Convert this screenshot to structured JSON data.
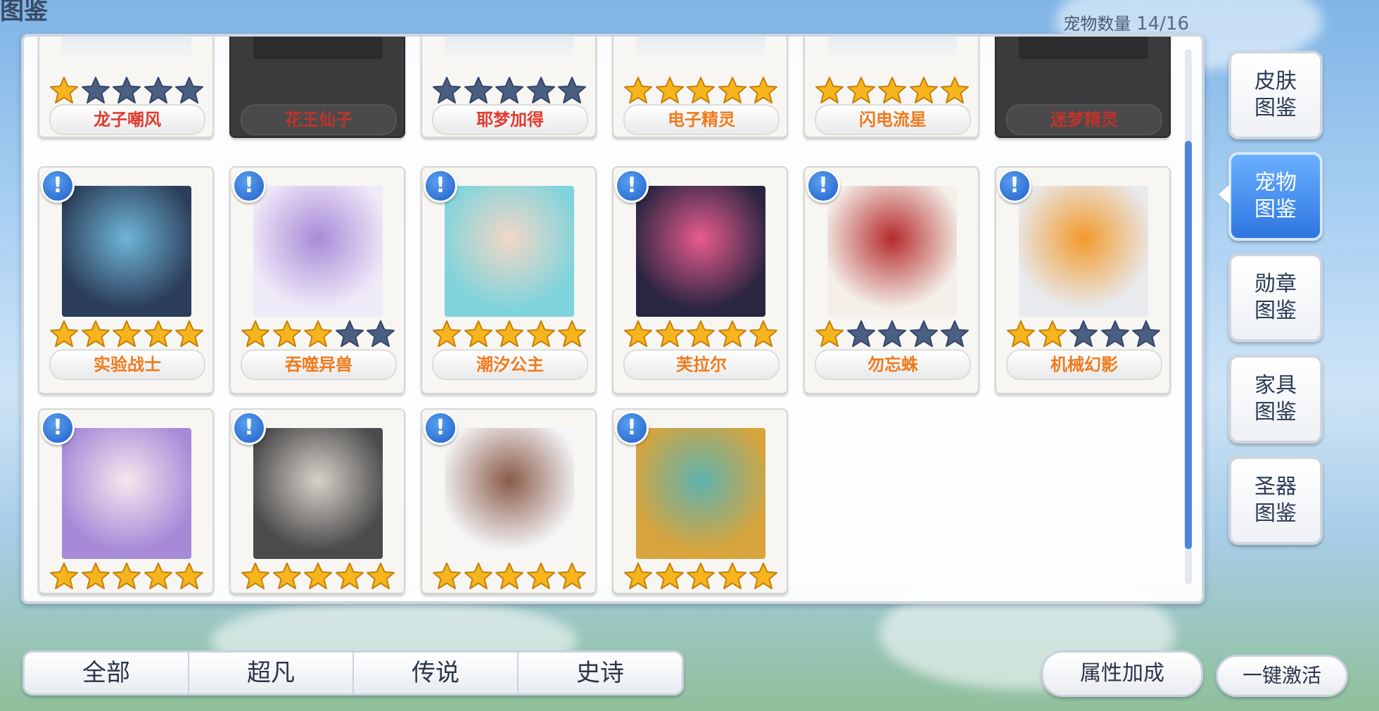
{
  "header": {
    "title": "图鉴",
    "count_label": "宠物数量",
    "count_value": "14/16"
  },
  "colors": {
    "accent": "#2e6fd8",
    "star_gold": "#f6b51d",
    "star_empty": "#4b5f82",
    "name_orange": "#f07a1c",
    "name_red": "#e13b2f"
  },
  "pets": [
    {
      "name": "龙子嘲风",
      "stars": 1,
      "locked": false,
      "alert": false,
      "name_color": "red"
    },
    {
      "name": "花王仙子",
      "stars": 0,
      "locked": true,
      "alert": false,
      "name_color": "red"
    },
    {
      "name": "耶梦加得",
      "stars": 0,
      "locked": false,
      "alert": false,
      "name_color": "red"
    },
    {
      "name": "电子精灵",
      "stars": 5,
      "locked": false,
      "alert": false,
      "name_color": "orange"
    },
    {
      "name": "闪电流星",
      "stars": 5,
      "locked": false,
      "alert": false,
      "name_color": "orange"
    },
    {
      "name": "迷梦精灵",
      "stars": 0,
      "locked": true,
      "alert": false,
      "name_color": "red"
    },
    {
      "name": "实验战士",
      "stars": 5,
      "locked": false,
      "alert": true,
      "name_color": "orange",
      "art_icon": "blue-warrior-art"
    },
    {
      "name": "吞噬异兽",
      "stars": 3,
      "locked": false,
      "alert": true,
      "name_color": "orange",
      "art_icon": "white-beast-art"
    },
    {
      "name": "潮汐公主",
      "stars": 5,
      "locked": false,
      "alert": true,
      "name_color": "orange",
      "art_icon": "mermaid-princess-art"
    },
    {
      "name": "芙拉尔",
      "stars": 5,
      "locked": false,
      "alert": true,
      "name_color": "orange",
      "art_icon": "dark-fairy-art"
    },
    {
      "name": "勿忘蛛",
      "stars": 1,
      "locked": false,
      "alert": true,
      "name_color": "orange",
      "art_icon": "spider-girl-art"
    },
    {
      "name": "机械幻影",
      "stars": 2,
      "locked": false,
      "alert": true,
      "name_color": "orange",
      "art_icon": "mech-robot-art"
    },
    {
      "name": "",
      "stars": 5,
      "locked": false,
      "alert": true,
      "art_icon": "oni-girl-art"
    },
    {
      "name": "",
      "stars": 5,
      "locked": false,
      "alert": true,
      "art_icon": "wolf-beast-art"
    },
    {
      "name": "",
      "stars": 5,
      "locked": false,
      "alert": true,
      "art_icon": "snow-yeti-art"
    },
    {
      "name": "",
      "stars": 5,
      "locked": false,
      "alert": true,
      "art_icon": "armored-turtle-art"
    }
  ],
  "side_tabs": [
    {
      "label": "皮肤\n图鉴",
      "active": false
    },
    {
      "label": "宠物\n图鉴",
      "active": true
    },
    {
      "label": "勋章\n图鉴",
      "active": false
    },
    {
      "label": "家具\n图鉴",
      "active": false
    },
    {
      "label": "圣器\n图鉴",
      "active": false
    }
  ],
  "filter_tabs": [
    {
      "label": "全部",
      "active": true
    },
    {
      "label": "超凡",
      "active": false
    },
    {
      "label": "传说",
      "active": false
    },
    {
      "label": "史诗",
      "active": false
    }
  ],
  "buttons": {
    "bonus": "属性加成",
    "activate_all": "一键激活"
  }
}
